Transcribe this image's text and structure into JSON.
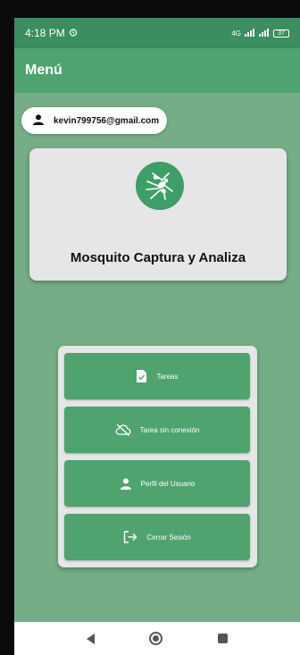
{
  "status": {
    "time": "4:18 PM",
    "alarm_icon": "alarm-icon",
    "signal_text": "4G",
    "battery": "37"
  },
  "appbar": {
    "title": "Menú"
  },
  "user": {
    "email": "kevin799756@gmail.com",
    "icon": "person-icon"
  },
  "brand": {
    "title": "Mosquito Captura y Analiza",
    "logo_icon": "mosquito-icon"
  },
  "menu": {
    "items": [
      {
        "label": "Tareas",
        "icon": "task-document-icon"
      },
      {
        "label": "Tarea sin conexión",
        "icon": "cloud-off-icon"
      },
      {
        "label": "Perfil del Usuario",
        "icon": "person-icon"
      },
      {
        "label": "Cerrar Sesión",
        "icon": "logout-icon"
      }
    ]
  },
  "colors": {
    "primary": "#4ea36f",
    "status_bar": "#3a8e5f",
    "background": "#74ad86",
    "card": "#e6e6e6"
  }
}
